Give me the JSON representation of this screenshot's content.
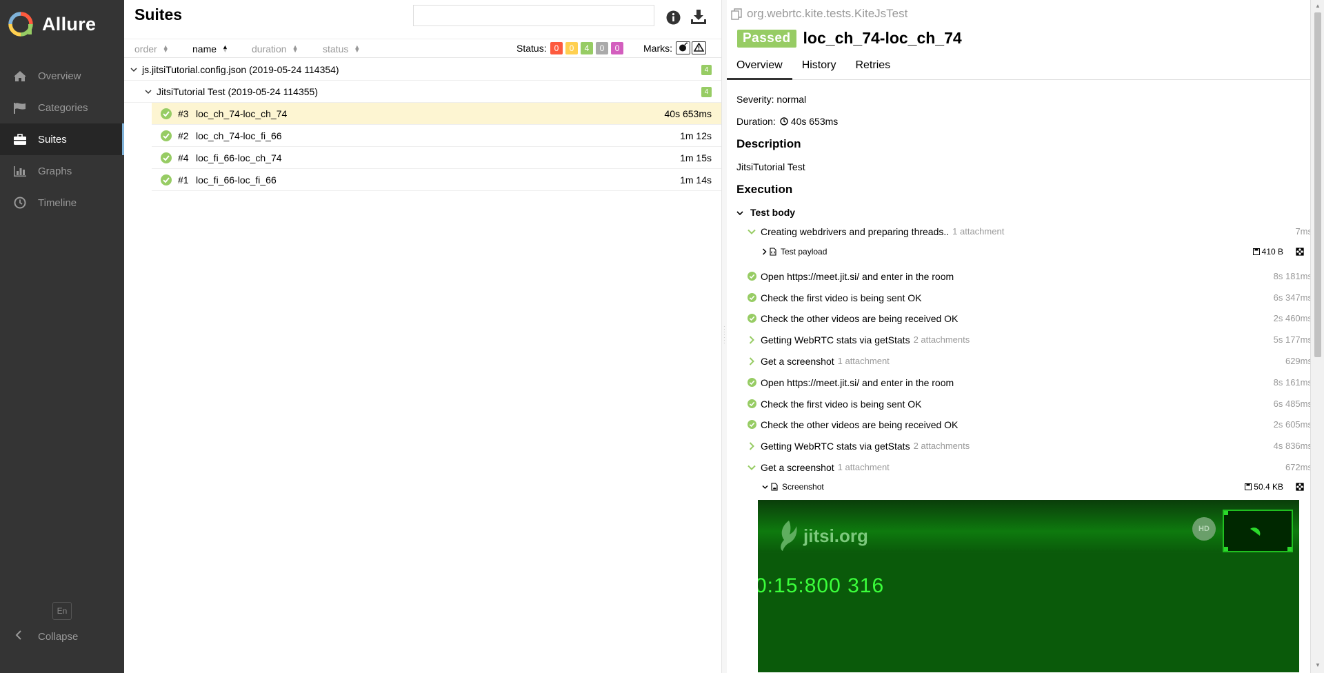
{
  "brand": {
    "name": "Allure"
  },
  "sidebar": {
    "items": [
      {
        "label": "Overview",
        "icon": "home-icon"
      },
      {
        "label": "Categories",
        "icon": "flag-icon"
      },
      {
        "label": "Suites",
        "icon": "briefcase-icon",
        "active": true
      },
      {
        "label": "Graphs",
        "icon": "bar-chart-icon"
      },
      {
        "label": "Timeline",
        "icon": "clock-icon"
      }
    ],
    "language": "En",
    "collapse_label": "Collapse"
  },
  "suites": {
    "title": "Suites",
    "search_placeholder": "",
    "sort": {
      "order": "order",
      "name": "name",
      "duration": "duration",
      "status": "status"
    },
    "status_label": "Status:",
    "counts": [
      {
        "value": "0",
        "color": "#fd5a3e"
      },
      {
        "value": "0",
        "color": "#ffd050"
      },
      {
        "value": "4",
        "color": "#97cc64"
      },
      {
        "value": "0",
        "color": "#aaaaaa"
      },
      {
        "value": "0",
        "color": "#d35ebe"
      }
    ],
    "marks_label": "Marks:",
    "tree": {
      "group": {
        "label": "js.jitsiTutorial.config.json (2019-05-24 114354)",
        "count": "4"
      },
      "subgroup": {
        "label": "JitsiTutorial Test (2019-05-24 114355)",
        "count": "4"
      },
      "tests": [
        {
          "num": "#3",
          "name": "loc_ch_74-loc_ch_74",
          "duration": "40s 653ms"
        },
        {
          "num": "#2",
          "name": "loc_ch_74-loc_fi_66",
          "duration": "1m 12s"
        },
        {
          "num": "#4",
          "name": "loc_fi_66-loc_ch_74",
          "duration": "1m 15s"
        },
        {
          "num": "#1",
          "name": "loc_fi_66-loc_fi_66",
          "duration": "1m 14s"
        }
      ]
    }
  },
  "detail": {
    "path": "org.webrtc.kite.tests.KiteJsTest",
    "status": "Passed",
    "name": "loc_ch_74-loc_ch_74",
    "tabs": [
      "Overview",
      "History",
      "Retries"
    ],
    "severity": "Severity: normal",
    "duration_label": "Duration:",
    "duration_value": "40s 653ms",
    "description_heading": "Description",
    "description": "JitsiTutorial Test",
    "execution_heading": "Execution",
    "test_body": "Test body",
    "steps": [
      {
        "name": "Creating webdrivers and preparing threads..",
        "attachments": "1 attachment",
        "time": "7ms",
        "icon": "chevron-down"
      },
      {
        "name": "Open https://meet.jit.si/ and enter in the room",
        "attachments": "",
        "time": "8s 181ms",
        "icon": "check"
      },
      {
        "name": "Check the first video is being sent OK",
        "attachments": "",
        "time": "6s 347ms",
        "icon": "check"
      },
      {
        "name": "Check the other videos are being received OK",
        "attachments": "",
        "time": "2s 460ms",
        "icon": "check"
      },
      {
        "name": "Getting WebRTC stats via getStats",
        "attachments": "2 attachments",
        "time": "5s 177ms",
        "icon": "chevron-right"
      },
      {
        "name": "Get a screenshot",
        "attachments": "1 attachment",
        "time": "629ms",
        "icon": "chevron-right"
      },
      {
        "name": "Open https://meet.jit.si/ and enter in the room",
        "attachments": "",
        "time": "8s 161ms",
        "icon": "check"
      },
      {
        "name": "Check the first video is being sent OK",
        "attachments": "",
        "time": "6s 485ms",
        "icon": "check"
      },
      {
        "name": "Check the other videos are being received OK",
        "attachments": "",
        "time": "2s 605ms",
        "icon": "check"
      },
      {
        "name": "Getting WebRTC stats via getStats",
        "attachments": "2 attachments",
        "time": "4s 836ms",
        "icon": "chevron-right"
      },
      {
        "name": "Get a screenshot",
        "attachments": "1 attachment",
        "time": "672ms",
        "icon": "chevron-down"
      }
    ],
    "attachment_payload": {
      "name": "Test payload",
      "size": "410 B"
    },
    "attachment_screenshot": {
      "name": "Screenshot",
      "size": "50.4 KB"
    },
    "screenshot": {
      "logo": "jitsi.org",
      "hd": "HD",
      "clock": "0:15:800 316"
    }
  },
  "colors": {
    "sidebar": "#343434",
    "passed": "#97cc64",
    "selected_row": "#fdf5d2"
  }
}
